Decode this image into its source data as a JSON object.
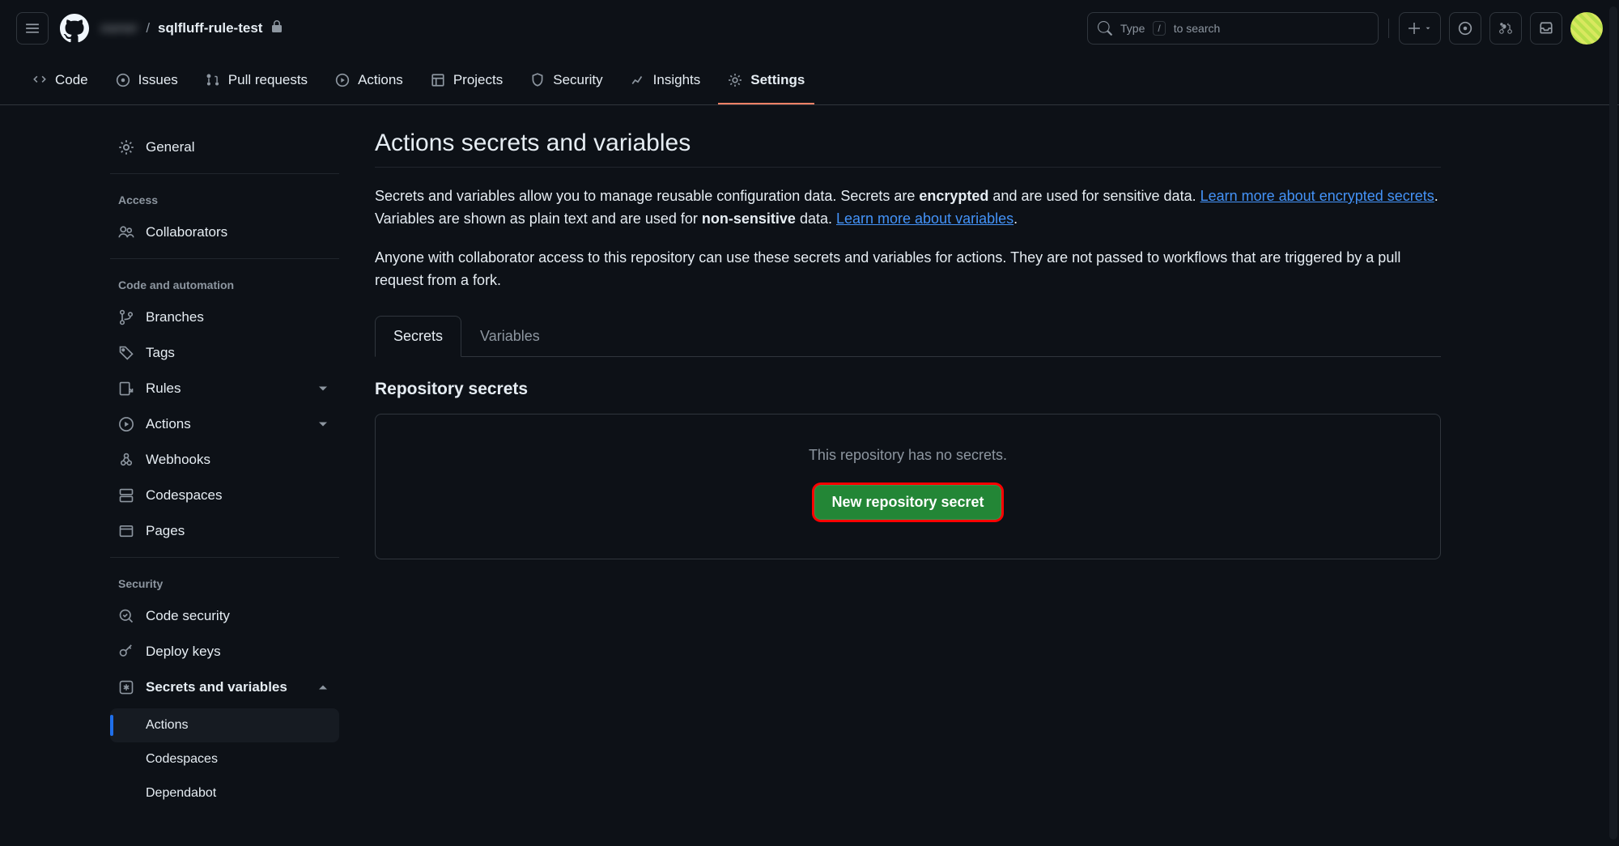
{
  "header": {
    "owner": "owner",
    "sep": "/",
    "repo": "sqlfluff-rule-test",
    "search_label_pre": "Type",
    "search_kbd": "/",
    "search_label_post": "to search"
  },
  "repo_tabs": [
    {
      "icon": "code",
      "label": "Code"
    },
    {
      "icon": "issue",
      "label": "Issues"
    },
    {
      "icon": "pr",
      "label": "Pull requests"
    },
    {
      "icon": "play",
      "label": "Actions"
    },
    {
      "icon": "project",
      "label": "Projects"
    },
    {
      "icon": "shield",
      "label": "Security"
    },
    {
      "icon": "graph",
      "label": "Insights"
    },
    {
      "icon": "gear",
      "label": "Settings"
    }
  ],
  "sidebar": {
    "general": "General",
    "heading_access": "Access",
    "collaborators": "Collaborators",
    "heading_auto": "Code and automation",
    "branches": "Branches",
    "tags": "Tags",
    "rules": "Rules",
    "actions": "Actions",
    "webhooks": "Webhooks",
    "codespaces": "Codespaces",
    "pages": "Pages",
    "heading_security": "Security",
    "code_security": "Code security",
    "deploy_keys": "Deploy keys",
    "secrets_vars": "Secrets and variables",
    "sub_actions": "Actions",
    "sub_codespaces": "Codespaces",
    "sub_dependabot": "Dependabot"
  },
  "content": {
    "title": "Actions secrets and variables",
    "p1_a": "Secrets and variables allow you to manage reusable configuration data. Secrets are ",
    "p1_enc": "encrypted",
    "p1_b": " and are used for sensitive data. ",
    "link1": "Learn more about encrypted secrets",
    "p1_c": ". Variables are shown as plain text and are used for ",
    "p1_nonsens": "non-sensitive",
    "p1_d": " data. ",
    "link2": "Learn more about variables",
    "p1_e": ".",
    "p2": "Anyone with collaborator access to this repository can use these secrets and variables for actions. They are not passed to workflows that are triggered by a pull request from a fork.",
    "tab_secrets": "Secrets",
    "tab_variables": "Variables",
    "section": "Repository secrets",
    "empty_msg": "This repository has no secrets.",
    "new_btn": "New repository secret"
  }
}
